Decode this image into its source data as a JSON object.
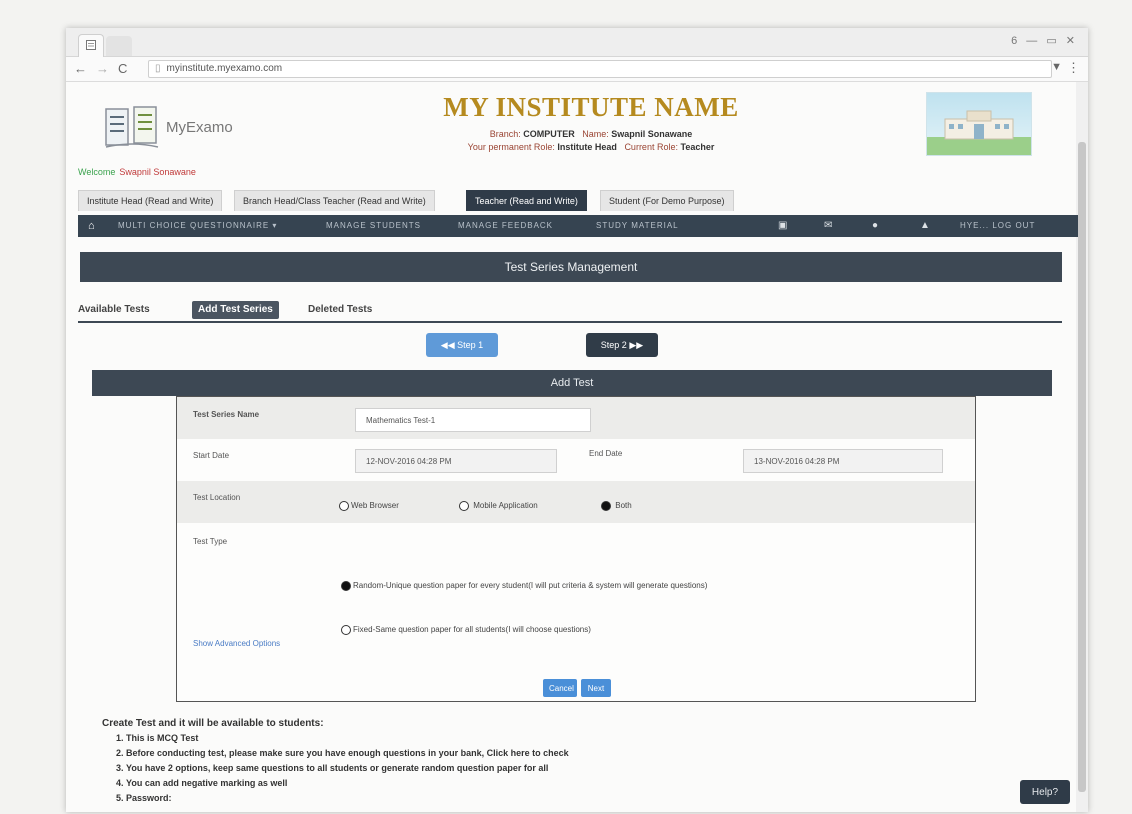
{
  "browser": {
    "url": "myinstitute.myexamo.com",
    "window_controls": "6 — ▭ ✕"
  },
  "header": {
    "logo_text": "MyExamo",
    "institute_name": "MY INSTITUTE NAME",
    "branch_label": "Branch:",
    "branch_value": "COMPUTER",
    "name_label": "Name:",
    "name_value": "Swapnil Sonawane",
    "permanent_role_label": "Your permanent Role:",
    "permanent_role_value": "Institute Head",
    "current_role_label": "Current Role:",
    "current_role_value": "Teacher",
    "welcome_label": "Welcome",
    "welcome_user": "Swapnil Sonawane"
  },
  "role_tabs": [
    {
      "label": "Institute Head (Read and Write)"
    },
    {
      "label": "Branch Head/Class Teacher (Read and Write)"
    },
    {
      "label": "Teacher (Read and Write)"
    },
    {
      "label": "Student (For Demo Purpose)"
    }
  ],
  "menu": {
    "items": [
      "MULTI CHOICE QUESTIONNAIRE ▾",
      "MANAGE STUDENTS",
      "MANAGE FEEDBACK",
      "STUDY MATERIAL"
    ],
    "logout": "HYE... LOG OUT"
  },
  "page": {
    "title": "Test Series Management",
    "subtabs": [
      "Available Tests",
      "Add Test Series",
      "Deleted Tests"
    ],
    "step1": "Step 1",
    "step2": "Step 2"
  },
  "form": {
    "section_title": "Add Test",
    "series_name_label": "Test Series Name",
    "series_name_value": "Mathematics Test-1",
    "start_date_label": "Start Date",
    "start_date_value": "12-NOV-2016 04:28 PM",
    "end_date_label": "End Date",
    "end_date_value": "13-NOV-2016 04:28 PM",
    "location_label": "Test Location",
    "location_options": [
      "Web Browser",
      "Mobile Application",
      "Both"
    ],
    "location_selected": "Both",
    "type_label": "Test Type",
    "type_options": [
      "Random-Unique question paper for every student(I will put criteria & system will generate questions)",
      "Fixed-Same question paper for all students(I will choose questions)"
    ],
    "type_selected": "Random",
    "advanced_link": "Show Advanced Options",
    "cancel_label": "Cancel",
    "next_label": "Next"
  },
  "notes": {
    "heading": "Create Test and it will be available to students:",
    "items": [
      "This is MCQ Test",
      "Before conducting test, please make sure you have enough questions in your bank, Click here to check",
      "You have 2 options, keep same questions to all students or generate random question paper for all",
      "You can add negative marking as well",
      "Password:"
    ]
  },
  "help_label": "Help?",
  "colors": {
    "nav_dark": "#364451",
    "panel_dark": "#3d4854",
    "accent_blue": "#4a8fd8",
    "institute_gold": "#b58a1f"
  }
}
